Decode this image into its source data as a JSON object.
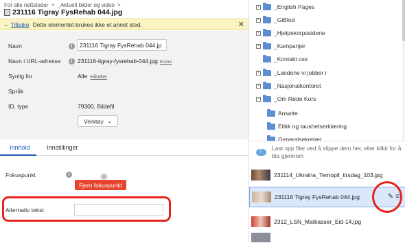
{
  "breadcrumb": {
    "root": "For alle nettsteder",
    "sep": ">",
    "child": "_Aktuelt bilder og video",
    "child_sep": ">"
  },
  "asset": {
    "title": "231116 Tigray FysRehab 044.jpg"
  },
  "notice": {
    "arrow": "←",
    "back_label": "Tilbake",
    "message": "Dette elementet brukes ikke et annet sted.",
    "close": "✕"
  },
  "props": {
    "name_label": "Navn",
    "name_value": "231116 Tigray FysRehab 044.jp",
    "url_label": "Navn i URL-adresse",
    "url_value": "231116-tigray-fysrehab-044.jpg",
    "url_edit": "Endre",
    "visible_label": "Synlig for",
    "visible_value": "Alle",
    "visible_manage": "Håndter",
    "lang_label": "Språk",
    "id_label": "ID, type",
    "id_value": "79300, Bildefil",
    "tools_label": "Verktøy",
    "tools_chevron": "⌄",
    "info_glyph": "i"
  },
  "tabs": {
    "content": "Innhold",
    "settings": "Innstillinger"
  },
  "focus": {
    "label": "Fokuspunkt",
    "remove_button": "Fjern fokuspunkt"
  },
  "alt_text": {
    "label": "Alternativ tekst",
    "value": ""
  },
  "tree": {
    "items": [
      {
        "label": "_English Pages",
        "expand": "+"
      },
      {
        "label": "_GiBlod",
        "expand": "+"
      },
      {
        "label": "_Hjelpekorpssidene",
        "expand": "+"
      },
      {
        "label": "_Kampanjer",
        "expand": "+"
      },
      {
        "label": "_Kontakt oss",
        "expand": ""
      },
      {
        "label": "_Landene vi jobber i",
        "expand": "+"
      },
      {
        "label": "_Nasjonalkontoret",
        "expand": "+"
      },
      {
        "label": "_Om Røde Kors",
        "expand": "−"
      },
      {
        "label": "Ansatte",
        "expand": ""
      },
      {
        "label": "Etikk og taushetserklæring",
        "expand": ""
      },
      {
        "label": "Generalsekretær",
        "expand": ""
      }
    ]
  },
  "upload": {
    "text": "Last opp filer ved å slippe dem her, eller klikk for å bla gjennom"
  },
  "files": [
    {
      "name": "231114_Ukraina_Ternopil_tirsdag_103.jpg"
    },
    {
      "name": "231116 Tigray FysRehab 044.jpg",
      "edit_icon": "✎",
      "menu_icon": "≡"
    },
    {
      "name": "2312_LSN_Matkasser_Eid-14.jpg"
    }
  ],
  "colors": {
    "accent": "#1a5fb4",
    "danger": "#e8432e",
    "notice_bg": "#fbf3c2",
    "folder": "#5b8fd1"
  }
}
